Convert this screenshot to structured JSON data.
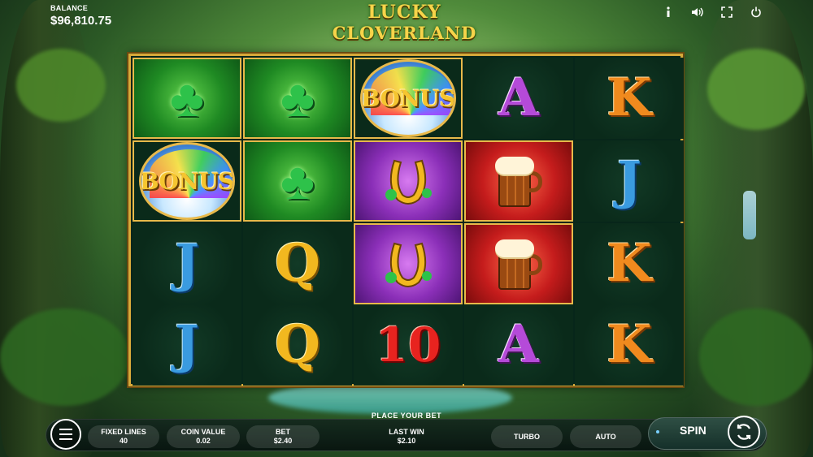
{
  "balance": {
    "label": "BALANCE",
    "value": "$96,810.75"
  },
  "logo": {
    "line1": "LUCKY",
    "line2": "CLOVERLAND"
  },
  "top_icons": [
    "info-icon",
    "sound-icon",
    "fullscreen-icon",
    "power-icon"
  ],
  "reels": {
    "columns": [
      [
        "clover",
        "bonus",
        "J",
        "J"
      ],
      [
        "clover",
        "clover",
        "Q",
        "Q"
      ],
      [
        "bonus",
        "horseshoe",
        "horseshoe",
        "10"
      ],
      [
        "A",
        "beer",
        "beer",
        "A"
      ],
      [
        "K",
        "J",
        "K",
        "K"
      ]
    ],
    "bonus_label": "BONUS",
    "letters": {
      "A": "A",
      "K": "K",
      "J": "J",
      "Q": "Q",
      "ten": "10"
    }
  },
  "bottom": {
    "place_bet": "PLACE YOUR BET",
    "fixed_lines": {
      "label": "FIXED LINES",
      "value": "40"
    },
    "coin_value": {
      "label": "COIN VALUE",
      "value": "0.02"
    },
    "bet": {
      "label": "BET",
      "value": "$2.40"
    },
    "last_win": {
      "label": "LAST WIN",
      "value": "$2.10"
    },
    "turbo": "TURBO",
    "auto": "AUTO",
    "spin": "SPIN"
  }
}
